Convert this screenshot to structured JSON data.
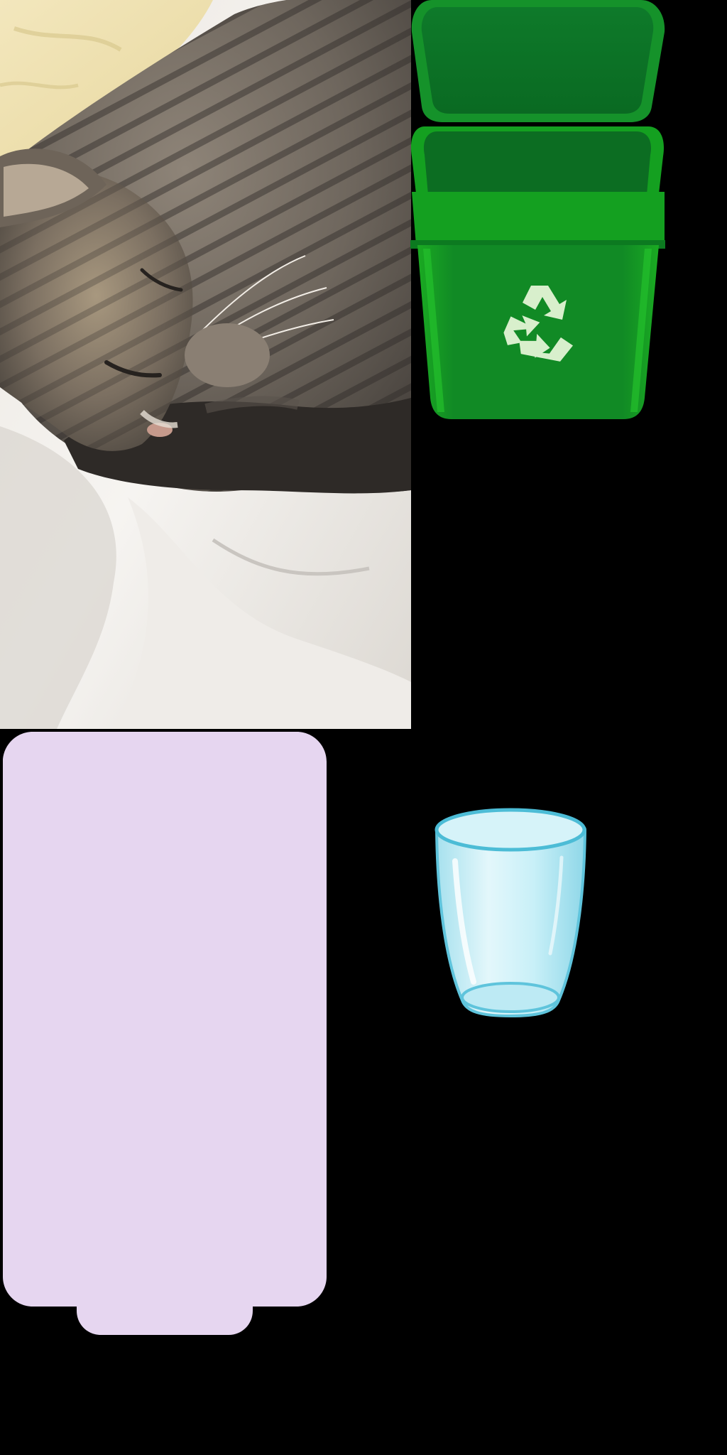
{
  "sheet": {
    "background_color": "#000000",
    "sprites": [
      {
        "name": "sleeping-tabby-cat-photo",
        "kind": "photo"
      },
      {
        "name": "green-recycle-bin",
        "kind": "icon",
        "color": "#1f9a2a",
        "symbol": "recycle-icon"
      },
      {
        "name": "lavender-rounded-panel",
        "kind": "shape",
        "color": "#e6d6f0"
      },
      {
        "name": "empty-drinking-glass",
        "kind": "icon",
        "color": "#b9ecf6"
      }
    ]
  }
}
